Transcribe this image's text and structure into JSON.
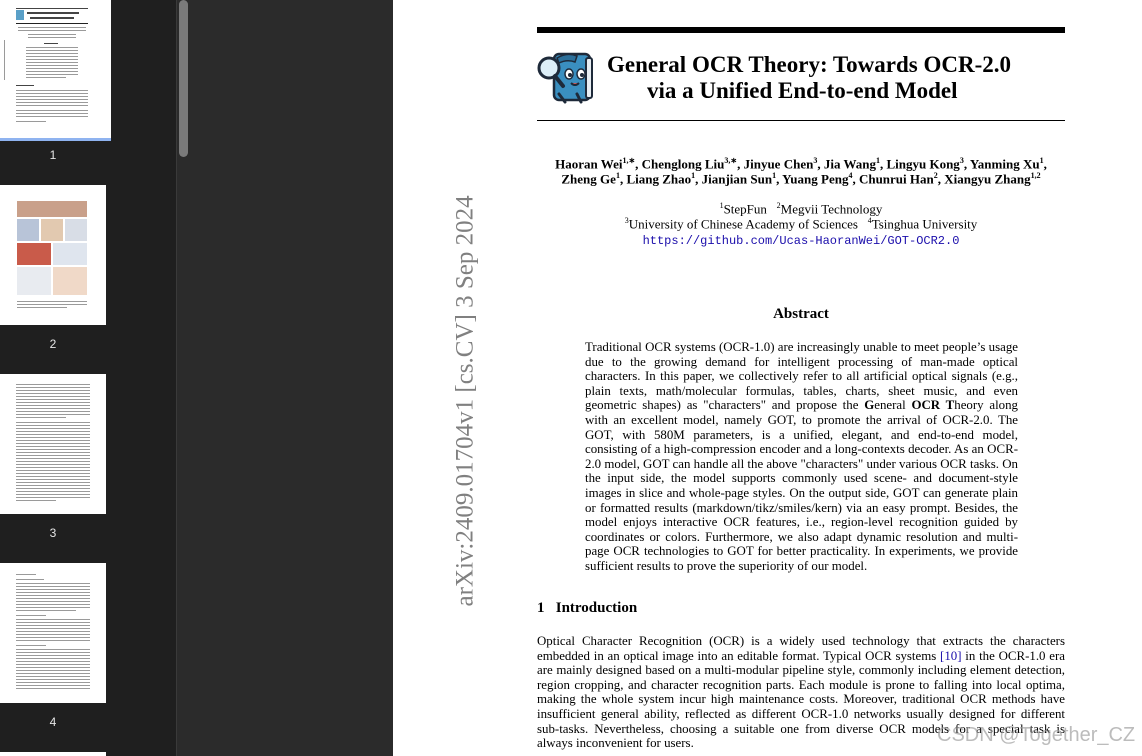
{
  "sidebar": {
    "thumbnails": [
      {
        "page": "1",
        "selected": true
      },
      {
        "page": "2",
        "selected": false
      },
      {
        "page": "3",
        "selected": false
      },
      {
        "page": "4",
        "selected": false
      }
    ]
  },
  "paper": {
    "arxiv_id": "arXiv:2409.01704v1  [cs.CV]  3 Sep 2024",
    "title_line1": "General OCR Theory: Towards OCR-2.0",
    "title_line2": "via a Unified End-to-end Model",
    "authors": [
      {
        "name": "Haoran Wei",
        "sup": "1,∗"
      },
      {
        "name": "Chenglong Liu",
        "sup": "3,∗"
      },
      {
        "name": "Jinyue Chen",
        "sup": "3"
      },
      {
        "name": "Jia Wang",
        "sup": "1"
      },
      {
        "name": "Lingyu Kong",
        "sup": "3"
      },
      {
        "name": "Yanming Xu",
        "sup": "1"
      },
      {
        "name": "Zheng Ge",
        "sup": "1"
      },
      {
        "name": "Liang Zhao",
        "sup": "1"
      },
      {
        "name": "Jianjian Sun",
        "sup": "1"
      },
      {
        "name": "Yuang Peng",
        "sup": "4"
      },
      {
        "name": "Chunrui Han",
        "sup": "2"
      },
      {
        "name": "Xiangyu Zhang",
        "sup": "1,2"
      }
    ],
    "affiliations": {
      "a1_sup": "1",
      "a1": "StepFun",
      "a2_sup": "2",
      "a2": "Megvii Technology",
      "a3_sup": "3",
      "a3": "University of Chinese Academy of Sciences",
      "a4_sup": "4",
      "a4": "Tsinghua University"
    },
    "repo_url": "https://github.com/Ucas-HaoranWei/GOT-OCR2.0",
    "abstract_heading": "Abstract",
    "abstract_part1": "Traditional OCR systems (OCR-1.0) are increasingly unable to meet people’s usage due to the growing demand for intelligent processing of man-made optical characters.  In this paper, we collectively refer to all artificial optical signals (e.g., plain texts, math/molecular formulas, tables, charts, sheet music, and even geometric shapes) as \"characters\" and propose the ",
    "abstract_bold1": "G",
    "abstract_mid1": "eneral ",
    "abstract_bold2": "OCR T",
    "abstract_part2": "heory along with an excellent model, namely GOT, to promote the arrival of OCR-2.0. The GOT, with 580M parameters, is a unified, elegant, and end-to-end model, consisting of a high-compression encoder and a long-contexts decoder. As an OCR-2.0 model, GOT can handle all the above \"characters\" under various OCR tasks.  On the input side, the model supports commonly used scene- and document-style images in slice and whole-page styles.  On the output side, GOT can generate plain or formatted results (markdown/tikz/smiles/kern) via an easy prompt. Besides, the model enjoys interactive OCR features, i.e., region-level recognition guided by coordinates or colors. Furthermore, we also adapt dynamic resolution and multi-page OCR technologies to GOT for better practicality. In experiments, we provide sufficient results to prove the superiority of our model.",
    "intro_number": "1",
    "intro_heading": "Introduction",
    "intro_part1": "Optical Character Recognition (OCR) is a widely used technology that extracts the characters embedded in an optical image into an editable format. Typical OCR systems ",
    "intro_cite": "[10]",
    "intro_part2": " in the OCR-1.0 era are mainly designed based on a multi-modular pipeline style, commonly including element detection, region cropping, and character recognition parts. Each module is prone to falling into local optima, making the whole system incur high maintenance costs. Moreover, traditional OCR methods have insufficient general ability, reflected as different OCR-1.0 networks usually designed for different sub-tasks.  Nevertheless, choosing a suitable one from diverse OCR models for a special task is always inconvenient for users."
  },
  "watermark": "CSDN @Together_CZ",
  "colors": {
    "sidebar_bg": "#1f1f1f",
    "viewer_bg": "#2b2b2b",
    "selected_frame": "#8fb3f0",
    "link": "#1a0dab"
  }
}
